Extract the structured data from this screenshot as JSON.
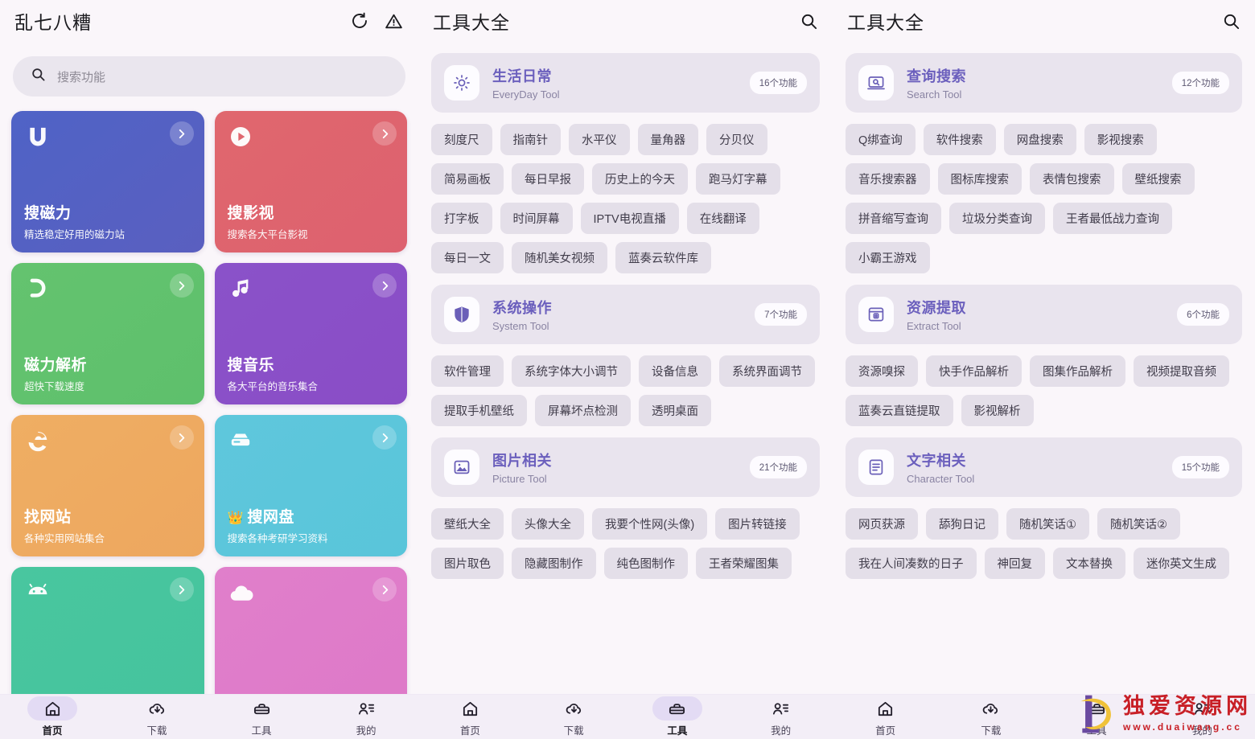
{
  "panel_left": {
    "appbar": {
      "title": "乱七八糟",
      "refresh_icon": "refresh-icon",
      "warning_icon": "warning-triangle-icon"
    },
    "search": {
      "placeholder": "搜索功能",
      "icon": "search-icon"
    },
    "cards": [
      {
        "title": "搜磁力",
        "subtitle": "精选稳定好用的磁力站",
        "glyph": "U",
        "icon_name": "magnet-u-icon",
        "color_from": "#4f63c6",
        "color_to": "#5a5fc0",
        "crown": ""
      },
      {
        "title": "搜影视",
        "subtitle": "搜索各大平台影视",
        "glyph": "▶",
        "icon_name": "play-circle-icon",
        "color_from": "#e0676e",
        "color_to": "#dd616f",
        "crown": ""
      },
      {
        "title": "磁力解析",
        "subtitle": "超快下载速度",
        "glyph": "⊃",
        "icon_name": "magnet-icon",
        "color_from": "#64c36f",
        "color_to": "#5ec06c",
        "crown": ""
      },
      {
        "title": "搜音乐",
        "subtitle": "各大平台的音乐集合",
        "glyph": "♫",
        "icon_name": "music-note-icon",
        "color_from": "#8a52c9",
        "color_to": "#8a4dc6",
        "crown": ""
      },
      {
        "title": "找网站",
        "subtitle": "各种实用网站集合",
        "glyph": "e",
        "icon_name": "browser-e-icon",
        "color_from": "#efae63",
        "color_to": "#eda75f",
        "crown": ""
      },
      {
        "title": "搜网盘",
        "subtitle": "搜索各种考研学习资料",
        "glyph": "▤",
        "icon_name": "disk-drive-icon",
        "color_from": "#5fc7dc",
        "color_to": "#59c5da",
        "crown": "👑"
      },
      {
        "title": "",
        "subtitle": "",
        "glyph": "🤖",
        "icon_name": "android-robot-icon",
        "color_from": "#49c69f",
        "color_to": "#45c49d",
        "crown": ""
      },
      {
        "title": "",
        "subtitle": "",
        "glyph": "☁",
        "icon_name": "cloud-icon",
        "color_from": "#e07fcb",
        "color_to": "#de79c8",
        "crown": ""
      }
    ],
    "bottomnav": [
      {
        "label": "首页",
        "icon": "home-icon",
        "active": true
      },
      {
        "label": "下载",
        "icon": "cloud-download-icon",
        "active": false
      },
      {
        "label": "工具",
        "icon": "toolbox-icon",
        "active": false
      },
      {
        "label": "我的",
        "icon": "user-list-icon",
        "active": false
      }
    ]
  },
  "panel_mid": {
    "appbar": {
      "title": "工具大全",
      "search_icon": "search-icon"
    },
    "sections": [
      {
        "cn": "生活日常",
        "en": "EveryDay Tool",
        "count": "16个功能",
        "icon": "sun-icon",
        "chips": [
          "刻度尺",
          "指南针",
          "水平仪",
          "量角器",
          "分贝仪",
          "简易画板",
          "每日早报",
          "历史上的今天",
          "跑马灯字幕",
          "打字板",
          "时间屏幕",
          "IPTV电视直播",
          "在线翻译",
          "每日一文",
          "随机美女视频",
          "蓝奏云软件库"
        ]
      },
      {
        "cn": "系统操作",
        "en": "System Tool",
        "count": "7个功能",
        "icon": "shield-icon",
        "chips": [
          "软件管理",
          "系统字体大小调节",
          "设备信息",
          "系统界面调节",
          "提取手机壁纸",
          "屏幕坏点检测",
          "透明桌面"
        ]
      },
      {
        "cn": "图片相关",
        "en": "Picture Tool",
        "count": "21个功能",
        "icon": "image-icon",
        "chips": [
          "壁纸大全",
          "头像大全",
          "我要个性网(头像)",
          "图片转链接",
          "图片取色",
          "隐藏图制作",
          "纯色图制作",
          "王者荣耀图集"
        ]
      }
    ],
    "bottomnav": [
      {
        "label": "首页",
        "icon": "home-icon",
        "active": false
      },
      {
        "label": "下载",
        "icon": "cloud-download-icon",
        "active": false
      },
      {
        "label": "工具",
        "icon": "toolbox-icon",
        "active": true
      },
      {
        "label": "我的",
        "icon": "user-list-icon",
        "active": false
      }
    ]
  },
  "panel_right": {
    "appbar": {
      "title": "工具大全",
      "search_icon": "search-icon"
    },
    "sections": [
      {
        "cn": "查询搜索",
        "en": "Search Tool",
        "count": "12个功能",
        "icon": "monitor-search-icon",
        "chips": [
          "Q绑查询",
          "软件搜索",
          "网盘搜索",
          "影视搜索",
          "音乐搜索器",
          "图标库搜索",
          "表情包搜索",
          "壁纸搜索",
          "拼音缩写查询",
          "垃圾分类查询",
          "王者最低战力查询",
          "小霸王游戏"
        ]
      },
      {
        "cn": "资源提取",
        "en": "Extract Tool",
        "count": "6个功能",
        "icon": "archive-extract-icon",
        "chips": [
          "资源嗅探",
          "快手作品解析",
          "图集作品解析",
          "视频提取音频",
          "蓝奏云直链提取",
          "影视解析"
        ]
      },
      {
        "cn": "文字相关",
        "en": "Character Tool",
        "count": "15个功能",
        "icon": "document-text-icon",
        "chips": [
          "网页获源",
          "舔狗日记",
          "随机笑话①",
          "随机笑话②",
          "我在人间凑数的日子",
          "神回复",
          "文本替换",
          "迷你英文生成"
        ]
      }
    ],
    "bottomnav": [
      {
        "label": "首页",
        "icon": "home-icon",
        "active": false
      },
      {
        "label": "下载",
        "icon": "cloud-download-icon",
        "active": false
      },
      {
        "label": "工具",
        "icon": "toolbox-icon",
        "active": false
      },
      {
        "label": "我的",
        "icon": "user-list-icon",
        "active": false
      }
    ],
    "watermark": {
      "name": "独爱资源网",
      "url": "www.duaiwang.cc",
      "color": "#c81f26"
    }
  }
}
